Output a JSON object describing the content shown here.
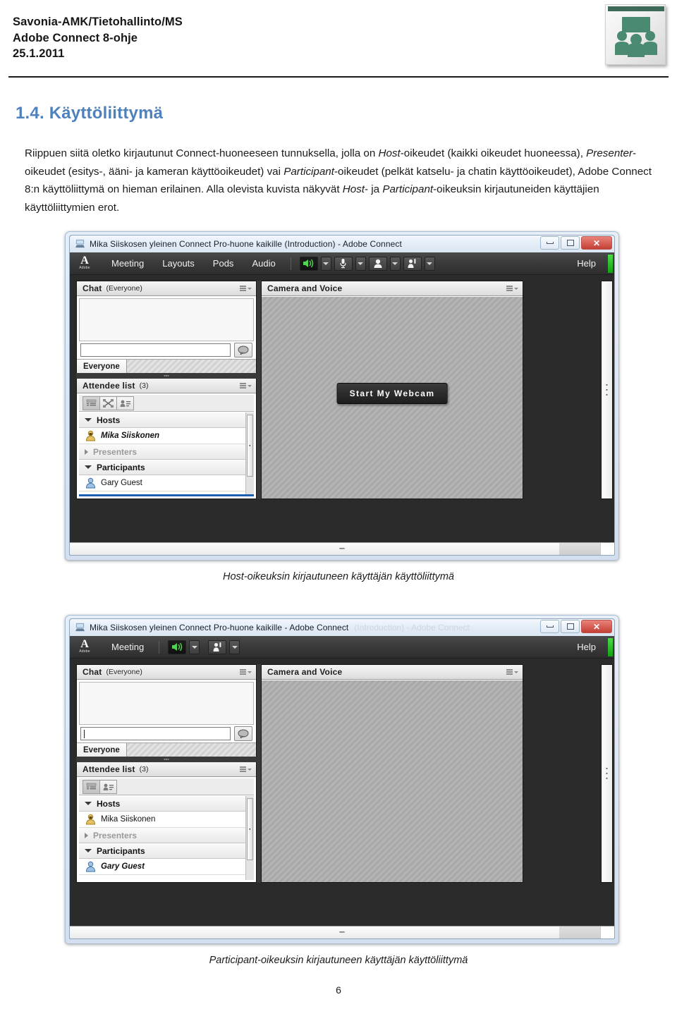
{
  "header": {
    "org_line": "Savonia-AMK/Tietohallinto/MS",
    "doc_line": "Adobe Connect 8-ohje",
    "date_line": "25.1.2011",
    "logo_name": "savonia-meeting-logo"
  },
  "section": {
    "number": "1.4.",
    "title": "Käyttöliittymä",
    "heading_full": "1.4. Käyttöliittymä",
    "heading_color": "#4f81bd"
  },
  "paragraph": {
    "p1": "Riippuen siitä oletko kirjautunut Connect-huoneeseen tunnuksella, jolla on ",
    "em1": "Host",
    "p2": "-oikeudet (kaikki oikeudet huoneessa), ",
    "em2": "Presenter",
    "p3": "-oikeudet (esitys-, ääni- ja kameran käyttöoikeudet) vai ",
    "em3": "Participant",
    "p4": "-oikeudet (pelkät katselu- ja chatin käyttöoikeudet), Adobe Connect 8:n käyttöliittymä on hieman erilainen. Alla olevista kuvista näkyvät ",
    "em4": "Host",
    "p5": "- ja ",
    "em5": "Participant",
    "p6": "-oikeuksin kirjautuneiden käyttäjien käyttöliittymien erot."
  },
  "window_host": {
    "title": "Mika Siiskosen yleinen Connect Pro-huone kaikille (Introduction) - Adobe Connect",
    "title_ghost": "",
    "window_buttons": {
      "minimize": "minimize-button",
      "maximize": "maximize-button",
      "close": "close-button",
      "close_glyph": "✕"
    },
    "brand": {
      "mark": "A",
      "caption": "Adobe"
    },
    "menu_items": [
      "Meeting",
      "Layouts",
      "Pods",
      "Audio"
    ],
    "toolbar_icons": [
      "speaker-icon",
      "microphone-icon",
      "webcam-icon",
      "raise-hand-icon"
    ],
    "help_label": "Help",
    "chat_pod": {
      "title": "Chat",
      "subtitle": "(Everyone)",
      "message_area_text": "",
      "input_value": "",
      "send_icon": "speech-bubble-icon",
      "tabs": [
        "Everyone"
      ]
    },
    "camera_pod": {
      "title": "Camera and Voice",
      "start_webcam_label": "Start My Webcam"
    },
    "attendee_pod": {
      "title": "Attendee list",
      "count": "(3)",
      "toolbar_icons": [
        "list-view-icon",
        "breakout-rooms-icon",
        "attendee-details-icon"
      ],
      "groups": [
        {
          "label": "Hosts",
          "expanded": true,
          "members": [
            {
              "name": "Mika Siiskonen",
              "role_icon": "host-badge-icon",
              "self": true
            }
          ]
        },
        {
          "label": "Presenters",
          "expanded": false,
          "members": []
        },
        {
          "label": "Participants",
          "expanded": true,
          "members": [
            {
              "name": "Gary Guest",
              "role_icon": "participant-icon",
              "self": false
            }
          ]
        }
      ]
    }
  },
  "caption_host": "Host-oikeuksin kirjautuneen käyttäjän käyttöliittymä",
  "window_participant": {
    "title": "Mika Siiskosen yleinen Connect Pro-huone kaikille - Adobe Connect",
    "title_ghost": "(Introduction) - Adobe Connect",
    "window_buttons": {
      "minimize": "minimize-button",
      "maximize": "maximize-button",
      "close": "close-button",
      "close_glyph": "✕"
    },
    "brand": {
      "mark": "A",
      "caption": "Adobe"
    },
    "menu_items": [
      "Meeting"
    ],
    "toolbar_icons": [
      "speaker-icon",
      "raise-hand-icon"
    ],
    "help_label": "Help",
    "chat_pod": {
      "title": "Chat",
      "subtitle": "(Everyone)",
      "message_area_text": "",
      "input_value": "",
      "send_icon": "speech-bubble-icon",
      "tabs": [
        "Everyone"
      ]
    },
    "camera_pod": {
      "title": "Camera and Voice",
      "start_webcam_label": ""
    },
    "attendee_pod": {
      "title": "Attendee list",
      "count": "(3)",
      "toolbar_icons": [
        "list-view-icon",
        "attendee-details-icon"
      ],
      "groups": [
        {
          "label": "Hosts",
          "expanded": true,
          "members": [
            {
              "name": "Mika Siiskonen",
              "role_icon": "host-badge-icon",
              "self": false
            }
          ]
        },
        {
          "label": "Presenters",
          "expanded": false,
          "members": []
        },
        {
          "label": "Participants",
          "expanded": true,
          "members": [
            {
              "name": "Gary Guest",
              "role_icon": "participant-icon",
              "self": true
            }
          ]
        }
      ]
    }
  },
  "caption_participant": "Participant-oikeuksin kirjautuneen käyttäjän käyttöliittymä",
  "page_number": "6"
}
